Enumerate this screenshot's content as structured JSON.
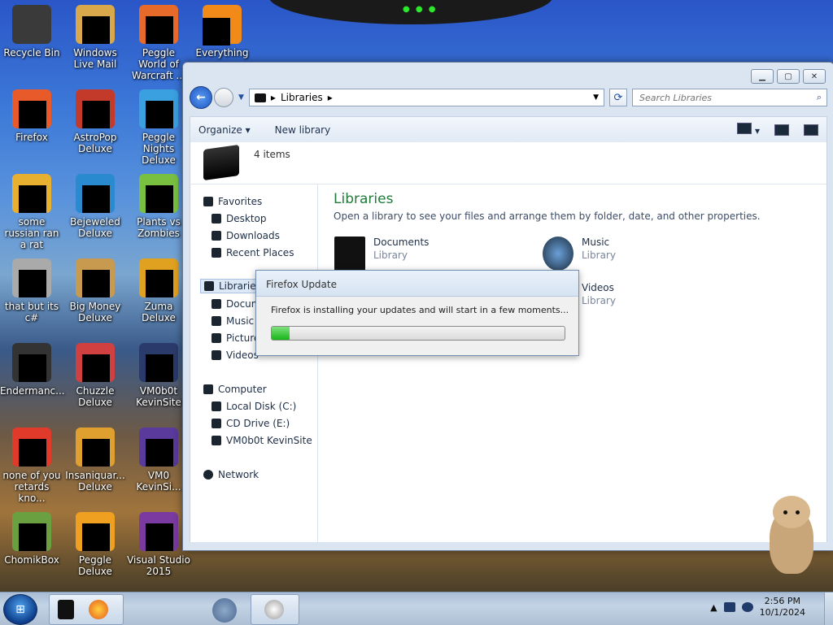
{
  "desktop_icons": [
    {
      "label": "Recycle Bin",
      "icon": "recycle-bin-icon"
    },
    {
      "label": "Windows Live Mail",
      "icon": "mail-icon"
    },
    {
      "label": "Peggle World of Warcraft ...",
      "icon": "game-icon"
    },
    {
      "label": "Everything",
      "icon": "search-app-icon"
    },
    {
      "label": "Firefox",
      "icon": "firefox-icon"
    },
    {
      "label": "AstroPop Deluxe",
      "icon": "game-icon"
    },
    {
      "label": "Peggle Nights Deluxe",
      "icon": "game-icon"
    },
    {
      "label": "some russian ran a rat",
      "icon": "app-icon"
    },
    {
      "label": "Bejeweled Deluxe",
      "icon": "game-icon"
    },
    {
      "label": "Plants vs Zombies",
      "icon": "game-icon"
    },
    {
      "label": "that but its c#",
      "icon": "app-icon"
    },
    {
      "label": "Big Money Deluxe",
      "icon": "game-icon"
    },
    {
      "label": "Zuma Deluxe",
      "icon": "game-icon"
    },
    {
      "label": "Endermanc...",
      "icon": "app-icon"
    },
    {
      "label": "Chuzzle Deluxe",
      "icon": "game-icon"
    },
    {
      "label": "VM0b0t KevinSite",
      "icon": "app-icon"
    },
    {
      "label": "none of you retards kno...",
      "icon": "app-icon"
    },
    {
      "label": "Insaniquar... Deluxe",
      "icon": "game-icon"
    },
    {
      "label": "VM0 KevinSi...",
      "icon": "app-icon"
    },
    {
      "label": "ChomikBox",
      "icon": "app-icon"
    },
    {
      "label": "Peggle Deluxe",
      "icon": "game-icon"
    },
    {
      "label": "Visual Studio 2015",
      "icon": "visual-studio-icon"
    }
  ],
  "explorer": {
    "address": "Libraries",
    "search_placeholder": "Search Libraries",
    "toolbar": {
      "organize": "Organize",
      "new_library": "New library"
    },
    "item_count": "4 items",
    "heading": "Libraries",
    "subheading": "Open a library to see your files and arrange them by folder, date, and other properties.",
    "nav": {
      "favorites": "Favorites",
      "desktop": "Desktop",
      "downloads": "Downloads",
      "recent": "Recent Places",
      "libraries": "Libraries",
      "documents": "Documents",
      "music": "Music",
      "pictures": "Pictures",
      "videos": "Videos",
      "computer": "Computer",
      "local_disk": "Local Disk (C:)",
      "cd_drive": "CD Drive (E:)",
      "vm_site": "VM0b0t KevinSite",
      "network": "Network"
    },
    "libraries": [
      {
        "name": "Documents",
        "type": "Library"
      },
      {
        "name": "Music",
        "type": "Library"
      },
      {
        "name": "Videos",
        "type": "Library"
      }
    ]
  },
  "dialog": {
    "title": "Firefox Update",
    "message": "Firefox is installing your updates and will start in a few moments...",
    "progress_percent": 6
  },
  "taskbar": {
    "time": "2:56 PM",
    "date": "10/1/2024"
  },
  "colors": {
    "heading_green": "#1e7b3a",
    "progress_green": "#17b617"
  }
}
